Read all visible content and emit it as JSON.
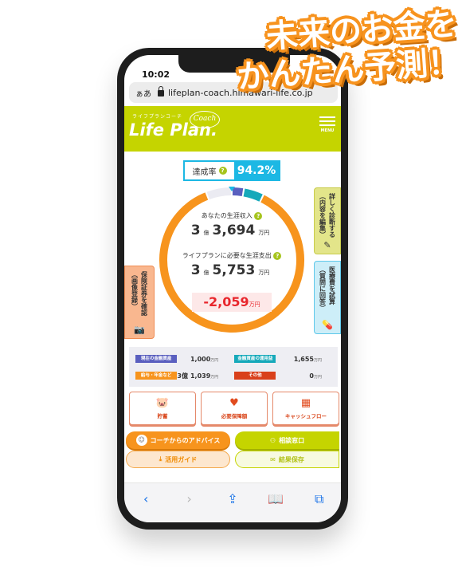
{
  "headline": {
    "line1": "未来のお金を",
    "line2": "かんたん予測！"
  },
  "status_bar": {
    "time": "10:02"
  },
  "browser": {
    "aa_label": "ぁあ",
    "url": "lifeplan-coach.himawari-life.co.jp"
  },
  "app_header": {
    "logo_sub": "ライフプランコーチ",
    "logo_main": "Life Plan.",
    "logo_coach": "Coach",
    "menu_label": "MENU"
  },
  "achievement": {
    "label": "達成率",
    "help": "?",
    "value": "94.2%"
  },
  "ring": {
    "colors": {
      "salary": "#f7941d",
      "current_assets": "#5a5fbf",
      "investment": "#16a9ba",
      "gap": "#ebebf2"
    },
    "segments_percent": {
      "gap": 5.8,
      "current_assets": 2.7,
      "investment": 4.5,
      "salary": 87.0
    }
  },
  "summary": {
    "income_label": "あなたの生涯収入",
    "income_oku": "3",
    "income_rest": "3,694",
    "expense_label": "ライフプランに必要な生涯支出",
    "expense_oku": "3",
    "expense_rest": "5,753",
    "oku_unit": "億",
    "man_unit": "万円",
    "difference": "-2,059",
    "help": "?"
  },
  "side_buttons": {
    "detail": {
      "line1": "詳しく診断する",
      "line2": "（内容を編集）",
      "icon": "✎"
    },
    "medical": {
      "line1": "医療費を試算",
      "line2": "（質問に回答）",
      "icon": "💊"
    },
    "insurance": {
      "line1": "保険証券を確認",
      "line2": "（画像登録）",
      "icon": "📷"
    }
  },
  "legend": [
    {
      "label": "現在の金融資産",
      "value": "1,000",
      "prefix": "",
      "unit": "万円",
      "color": "#5a5fbf"
    },
    {
      "label": "金融資産の運用益",
      "value": "1,655",
      "prefix": "",
      "unit": "万円",
      "color": "#16a9ba"
    },
    {
      "label": "給与・年金など",
      "value": "1,039",
      "prefix": "3億",
      "unit": "万円",
      "color": "#f7941d"
    },
    {
      "label": "その他",
      "value": "0",
      "prefix": "",
      "unit": "万円",
      "color": "#d9401b"
    }
  ],
  "tools": [
    {
      "label": "貯蓄",
      "icon": "🐷"
    },
    {
      "label": "必要保障額",
      "icon": "♥"
    },
    {
      "label": "キャッシュフロー",
      "icon": "▦"
    }
  ],
  "actions": {
    "advice": "コーチからのアドバイス",
    "consult": "相談窓口",
    "guide": "活用ガイド",
    "save": "結果保存"
  },
  "safari_nav": {
    "back": "‹",
    "forward": "›",
    "share": "⇪",
    "bookmarks": "📖",
    "tabs": "⧉"
  }
}
